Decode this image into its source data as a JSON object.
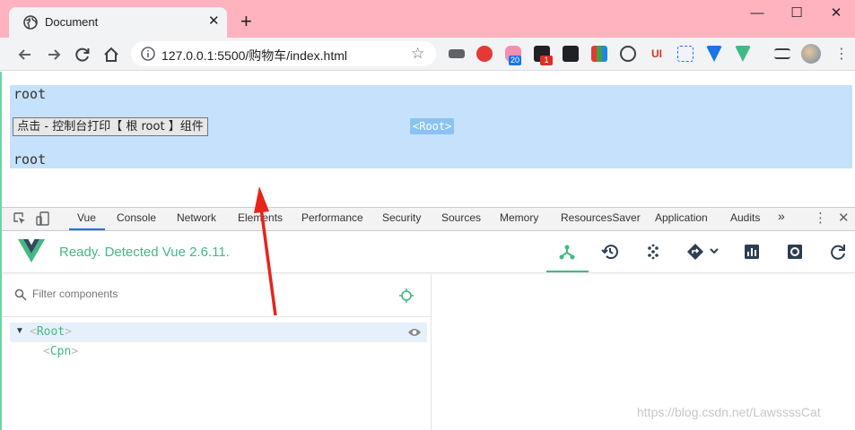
{
  "browser": {
    "tab_title": "Document",
    "url": "127.0.0.1:5500/购物车/index.html",
    "ext_badges": {
      "b1": "20",
      "b2": "1"
    }
  },
  "page": {
    "root_text_top": "root",
    "button_label": "点击 - 控制台打印【 根 root 】组件",
    "root_tag": "<Root>",
    "root_text_bottom": "root"
  },
  "devtools": {
    "tabs": [
      "Vue",
      "Console",
      "Network",
      "Elements",
      "Performance",
      "Security",
      "Sources",
      "Memory",
      "ResourcesSaver",
      "Application",
      "Audits"
    ],
    "more": "»"
  },
  "vue": {
    "status": "Ready. Detected Vue 2.6.11.",
    "filter_placeholder": "Filter components",
    "tree": {
      "root": {
        "open": "<",
        "name": "Root",
        "close": ">"
      },
      "child": {
        "open": "<",
        "name": "Cpn",
        "close": ">"
      }
    }
  },
  "watermark": "https://blog.csdn.net/LawssssCat",
  "colors": {
    "titlebar": "#ffb3bf",
    "vue_green": "#42b983",
    "selection": "#c5e1fb"
  }
}
